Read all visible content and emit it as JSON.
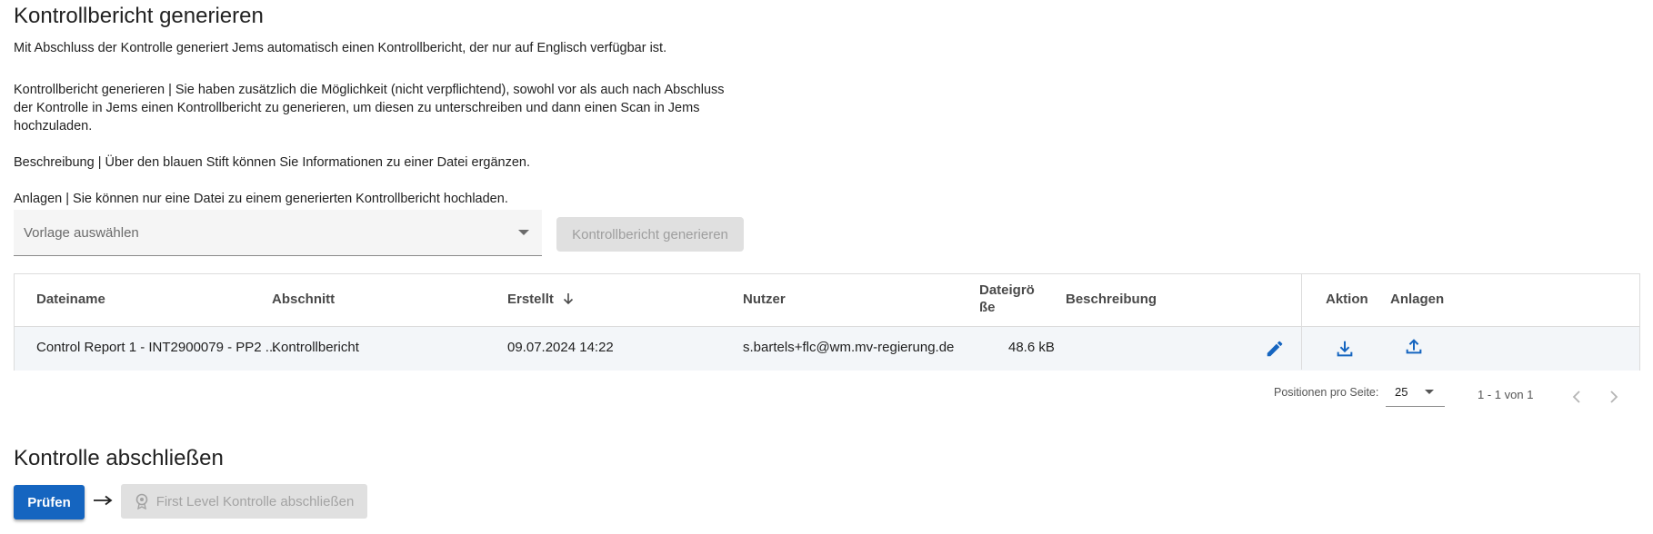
{
  "section1": {
    "title": "Kontrollbericht generieren",
    "p1": "Mit Abschluss der Kontrolle generiert Jems automatisch einen Kontrollbericht, der nur auf Englisch verfügbar ist.",
    "p2_line1": "Kontrollbericht generieren | Sie haben zusätzlich die Möglichkeit (nicht verpflichtend), sowohl vor als auch nach Abschluss",
    "p2_line2": "der Kontrolle in Jems einen Kontrollbericht zu generieren, um diesen zu unterschreiben und dann einen Scan in Jems",
    "p2_line3": "hochzuladen.",
    "p3": "Beschreibung | Über den blauen Stift können Sie Informationen zu einer Datei ergänzen.",
    "p4": "Anlagen | Sie können nur eine Datei zu einem generierten Kontrollbericht hochladen.",
    "template_select_placeholder": "Vorlage auswählen",
    "generate_button": "Kontrollbericht generieren"
  },
  "table": {
    "headers": {
      "filename": "Dateiname",
      "section": "Abschnitt",
      "created": "Erstellt",
      "user": "Nutzer",
      "filesize_line1": "Dateigrö",
      "filesize_line2": "ße",
      "description": "Beschreibung",
      "action": "Aktion",
      "attachments": "Anlagen"
    },
    "rows": [
      {
        "filename": "Control Report 1 - INT2900079 - PP2 ...",
        "section": "Kontrollbericht",
        "created": "09.07.2024 14:22",
        "user": "s.bartels+flc@wm.mv-regierung.de",
        "filesize": "48.6 kB",
        "description": ""
      }
    ],
    "icons": {
      "edit": "pencil-icon",
      "download": "download-icon",
      "upload": "upload-icon",
      "sort": "arrow-down-icon"
    }
  },
  "pager": {
    "label": "Positionen pro Seite:",
    "page_size": "25",
    "range": "1 - 1 von 1"
  },
  "section2": {
    "title": "Kontrolle abschließen",
    "check_button": "Prüfen",
    "finish_button": "First Level Kontrolle abschließen"
  },
  "colors": {
    "primary": "#1565c0",
    "disabled_bg": "#e0e0e0",
    "disabled_text": "#9e9e9e",
    "row_bg": "#f3f6f9"
  }
}
